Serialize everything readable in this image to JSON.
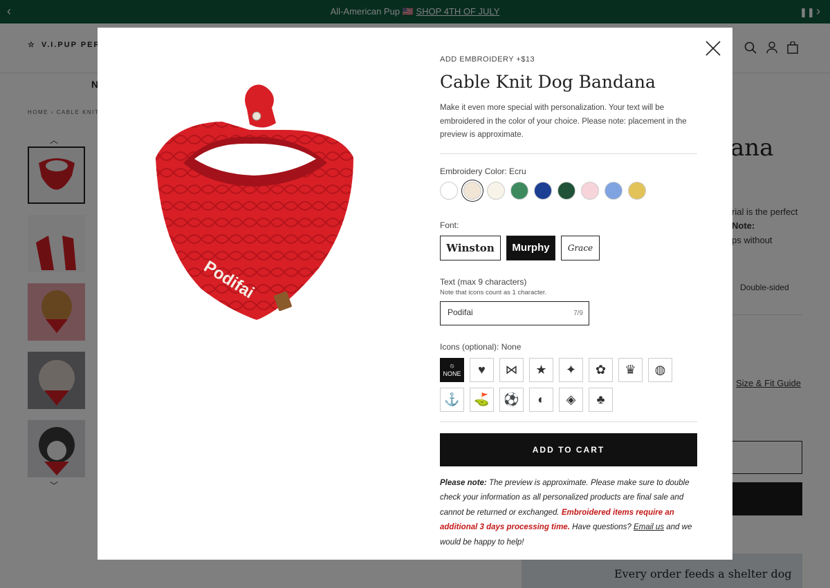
{
  "announcement": {
    "text": "All-American Pup 🇺🇸",
    "link": "SHOP 4TH OF JULY",
    "prev_icon": "chevron-left-icon",
    "pause_icon": "pause-icon",
    "next_icon": "chevron-right-icon"
  },
  "header": {
    "logo": "V.I.PUP PERKS",
    "nav_partial": "N",
    "icons": [
      "search-icon",
      "account-icon",
      "bag-icon"
    ]
  },
  "breadcrumb": "HOME › CABLE KNIT DOG",
  "product_bg": {
    "title_partial": "ana",
    "line1": "rial is the perfect",
    "line2": "Note:",
    "line3": "ps without",
    "option_label": "Double-sided",
    "size_guide": "Size & Fit Guide",
    "feed_title": "Every order feeds a shelter dog"
  },
  "modal": {
    "eyebrow": "ADD EMBROIDERY +$13",
    "title": "Cable Knit Dog Bandana",
    "description": "Make it even more special with personalization. Your text will be embroidered in the color of your choice. Please note: placement in the preview is approximate.",
    "embroidery_label": "Embroidery Color: Ecru",
    "swatches": [
      "#ffffff",
      "#f1e6d6",
      "#f7f3e8",
      "#3d8a5e",
      "#1c3f94",
      "#1f5236",
      "#f6d4d9",
      "#7fa3e0",
      "#e2c35a"
    ],
    "selected_swatch": 1,
    "font_label": "Font:",
    "fonts": [
      "Winston",
      "Murphy",
      "Grace"
    ],
    "selected_font": "Murphy",
    "text_label": "Text (max 9 characters)",
    "text_note": "Note that icons count as 1 character.",
    "text_value": "Podifai",
    "text_count": "7/9",
    "icons_label": "Icons (optional): None",
    "icon_none_label": "NONE",
    "icon_glyphs": [
      "♥",
      "⋈",
      "★",
      "✦",
      "✿",
      "♛",
      "◍",
      "⚓",
      "⛳",
      "⚽",
      "◐",
      "◈",
      "♣"
    ],
    "add_to_cart": "ADD TO CART",
    "note_bold": "Please note:",
    "note_text": " The preview is approximate. Please make sure to double check your information as all personalized products are final sale and cannot be returned or exchanged. ",
    "note_red": "Embroidered items require an additional 3 days processing time.",
    "note_q": " Have questions? ",
    "note_link": "Email us",
    "note_end": " and we would be happy to help!",
    "preview_text": "Podifai",
    "colors": {
      "bandana": "#d81f26",
      "bandana_dark": "#b5141b",
      "accent": "#0f5a3e"
    }
  }
}
